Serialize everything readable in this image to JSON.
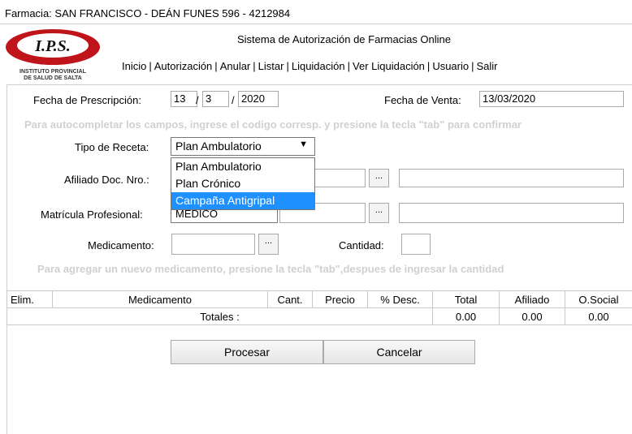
{
  "header": {
    "pharmacy": "Farmacia: SAN FRANCISCO - DEÁN FUNES 596 - 4212984",
    "system_title": "Sistema de Autorización de Farmacias Online",
    "logo_text": "I.P.S.",
    "logo_subtitle_1": "INSTITUTO PROVINCIAL",
    "logo_subtitle_2": "DE SALUD DE SALTA"
  },
  "menu": {
    "items": [
      "Inicio",
      "Autorización",
      "Anular",
      "Listar",
      "Liquidación",
      "Ver Liquidación",
      "Usuario",
      "Salir"
    ],
    "separator": "|"
  },
  "form": {
    "prescription_label": "Fecha de Prescripción:",
    "prescription_day": "13",
    "prescription_month": "3",
    "prescription_year": "2020",
    "date_sep": "/",
    "sale_label": "Fecha de Venta:",
    "sale_date": "13/03/2020",
    "hint_autocomplete": "Para autocompletar los campos, ingrese el codigo corresp. y presione la tecla \"tab\" para confirmar",
    "recipe_type_label": "Tipo de Receta:",
    "recipe_type_value": "Plan Ambulatorio",
    "recipe_type_options": [
      "Plan Ambulatorio",
      "Plan Crónico",
      "Campaña Antigripal"
    ],
    "affiliate_label": "Afiliado Doc. Nro.:",
    "license_label": "Matrícula Profesional:",
    "license_select_value": "MEDICO",
    "medication_label": "Medicamento:",
    "quantity_label": "Cantidad:",
    "lookup_button": "...",
    "hint_new_med": "Para agregar un nuevo medicamento, presione la tecla \"tab\",despues de ingresar la cantidad"
  },
  "table": {
    "columns": [
      "Elim.",
      "Medicamento",
      "Cant.",
      "Precio",
      "% Desc.",
      "Total",
      "Afiliado",
      "O.Social"
    ],
    "totals_label": "Totales :",
    "totals": [
      "0.00",
      "0.00",
      "0.00"
    ]
  },
  "actions": {
    "process": "Procesar",
    "cancel": "Cancelar"
  },
  "colors": {
    "logo_red": "#c0141b",
    "selected_option": "#1e90ff",
    "hint_text": "#d0d0d0"
  }
}
